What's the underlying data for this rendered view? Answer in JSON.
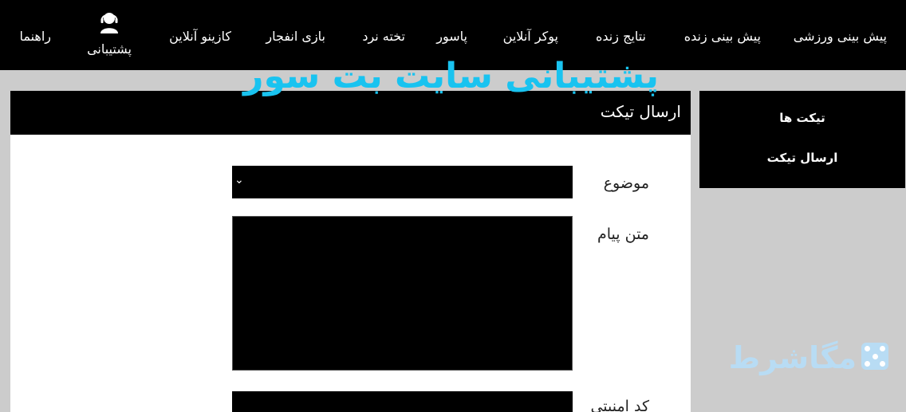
{
  "nav": {
    "items": [
      {
        "label": "پیش بینی ورزشی"
      },
      {
        "label": "پیش بینی زنده"
      },
      {
        "label": "نتایج زنده"
      },
      {
        "label": "پوکر آنلاین"
      },
      {
        "label": "پاسور"
      },
      {
        "label": "تخته نرد"
      },
      {
        "label": "بازی انفجار"
      },
      {
        "label": "کازینو آنلاین"
      },
      {
        "label": "پشتیبانی",
        "icon": "user-support-icon"
      },
      {
        "label": "راهنما"
      }
    ]
  },
  "overlay": {
    "title": "پشتیبانی سایت بت سور",
    "title_color": "#19c3f0",
    "brand_text": "مگاشرط",
    "brand_color": "#b8dcf4"
  },
  "sidebar": {
    "items": [
      {
        "label": "تیکت ها"
      },
      {
        "label": "ارسال تیکت"
      }
    ]
  },
  "panel": {
    "title": "ارسال تیکت"
  },
  "form": {
    "subject_label": "موضوع",
    "subject_value": "",
    "message_label": "متن پیام",
    "message_value": "",
    "captcha_label": "کد امنیتی",
    "captcha_value": ""
  }
}
